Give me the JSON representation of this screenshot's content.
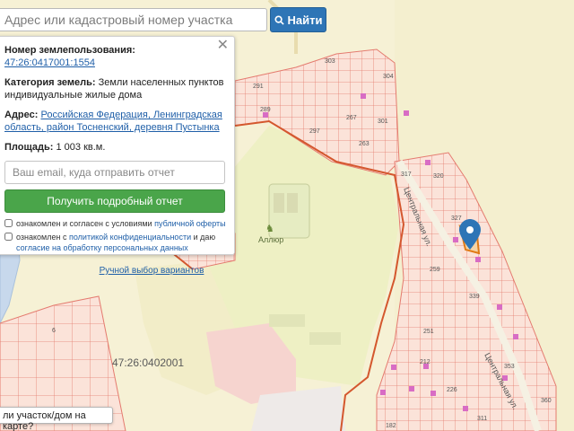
{
  "search": {
    "placeholder": "Адрес или кадастровый номер участка",
    "button_label": "Найти",
    "button_icon": "search-icon"
  },
  "panel": {
    "close_label": "✕",
    "land_use_label": "Номер землепользования:",
    "land_use_value": "47:26:0417001:1554",
    "category_label": "Категория земель:",
    "category_value": "Земли населенных пунктов индивидуальные жилые дома",
    "address_label": "Адрес:",
    "address_value": "Российская Федерация, Ленинградская область, район Тосненский, деревня Пустынка",
    "area_label": "Площадь:",
    "area_value": "1 003 кв.м.",
    "email_placeholder": "Ваш email, куда отправить отчет",
    "report_button": "Получить подробный отчет",
    "consent1_prefix": "ознакомлен и согласен с условиями",
    "consent1_link": "публичной оферты",
    "consent2_prefix": "ознакомлен с",
    "consent2_link1": "политикой конфиденциальности",
    "consent2_mid": "и даю",
    "consent2_link2": "согласие на обработку персональных данных",
    "manual_link": "Ручной выбор вариантов"
  },
  "bottom_tab": "ли участок/дом на карте?",
  "map": {
    "cadastral_block": "47:26:0402001",
    "place_label": "Аллюр",
    "street_label_1": "Центральная ул.",
    "street_label_2": "Центральная ул.",
    "plot_numbers": [
      "303",
      "304",
      "291",
      "289",
      "267",
      "297",
      "301",
      "263",
      "317",
      "320",
      "327",
      "259",
      "339",
      "251",
      "6",
      "212",
      "353",
      "226",
      "360",
      "311",
      "182"
    ],
    "colors": {
      "background": "#f6f1d5",
      "settlement_fill": "#fbe3d9",
      "settlement_stroke": "#e47b6f",
      "boundary": "#d4572e",
      "road": "#e8dcae",
      "water": "#c7d8ec",
      "forest": "#e4ecc6",
      "green_area": "#eef0c4",
      "building": "#d86cc4",
      "marker": "#2e75b6"
    }
  }
}
